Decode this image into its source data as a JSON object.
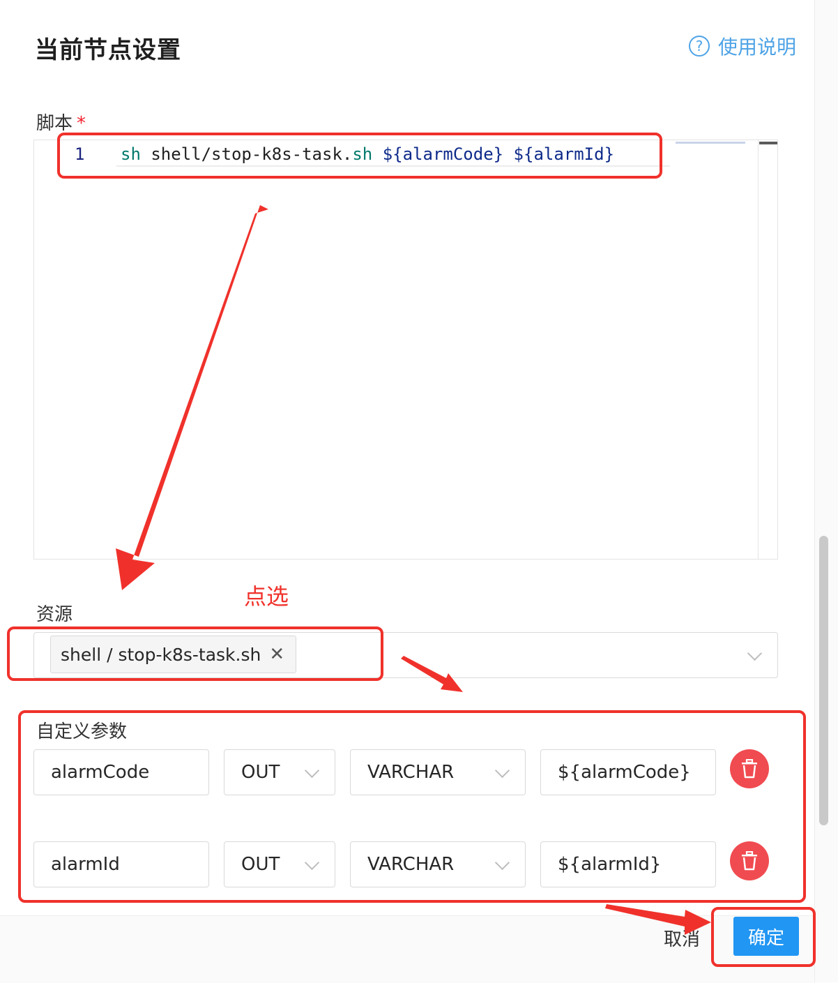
{
  "header": {
    "title": "当前节点设置",
    "help_label": "使用说明",
    "help_icon": "question-circle-icon"
  },
  "script": {
    "label": "脚本",
    "required_mark": "*",
    "line_number": "1",
    "code_tokens": [
      "sh",
      " shell/stop-k8s-task.",
      "sh",
      " ${alarmCode} ${alarmId}"
    ]
  },
  "resource": {
    "label": "资源",
    "selected_tag": "shell / stop-k8s-task.sh",
    "remove_glyph": "✕"
  },
  "custom_params": {
    "label": "自定义参数",
    "rows": [
      {
        "prop": "alarmCode",
        "direct": "OUT",
        "type": "VARCHAR",
        "value": "${alarmCode}"
      },
      {
        "prop": "alarmId",
        "direct": "OUT",
        "type": "VARCHAR",
        "value": "${alarmId}"
      }
    ]
  },
  "footer": {
    "cancel_label": "取消",
    "confirm_label": "确定"
  },
  "annotation": {
    "hint_text": "点选",
    "color": "#f0312b"
  },
  "colors": {
    "accent": "#2196f3",
    "delete": "#f04b50",
    "help": "#4ea3e6"
  }
}
